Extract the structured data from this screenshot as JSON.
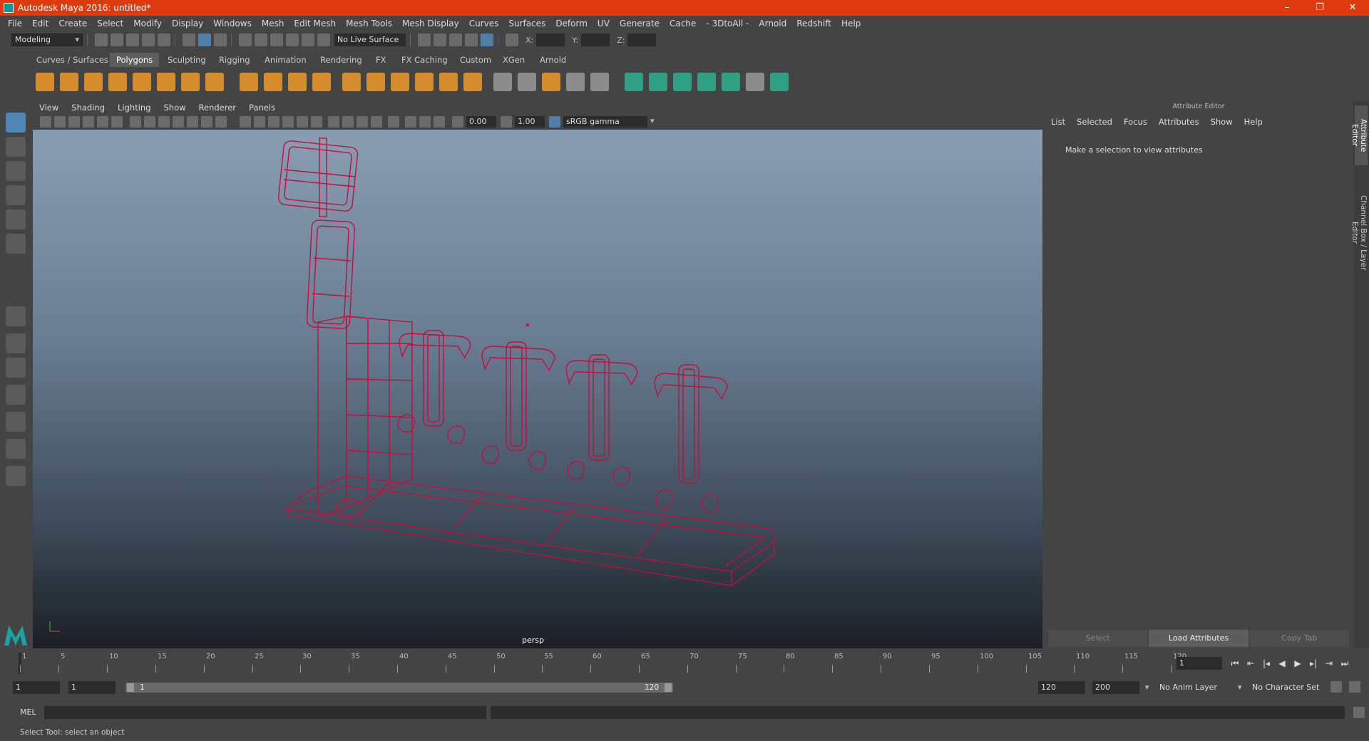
{
  "window": {
    "title": "Autodesk Maya 2016: untitled*",
    "minimize": "–",
    "maximize": "❐",
    "close": "✕"
  },
  "menubar": [
    "File",
    "Edit",
    "Create",
    "Select",
    "Modify",
    "Display",
    "Windows",
    "Mesh",
    "Edit Mesh",
    "Mesh Tools",
    "Mesh Display",
    "Curves",
    "Surfaces",
    "Deform",
    "UV",
    "Generate",
    "Cache",
    "- 3DtoAll -",
    "Arnold",
    "Redshift",
    "Help"
  ],
  "status_line": {
    "mode": "Modeling",
    "live_surface": "No Live Surface",
    "x_label": "X:",
    "y_label": "Y:",
    "z_label": "Z:"
  },
  "shelf": {
    "tabs": [
      "Curves / Surfaces",
      "Polygons",
      "Sculpting",
      "Rigging",
      "Animation",
      "Rendering",
      "FX",
      "FX Caching",
      "Custom",
      "XGen",
      "Arnold"
    ],
    "active_tab": "Polygons"
  },
  "panel": {
    "menus": [
      "View",
      "Shading",
      "Lighting",
      "Show",
      "Renderer",
      "Panels"
    ],
    "exposure": "0.00",
    "gamma": "1.00",
    "color_space": "sRGB gamma",
    "camera": "persp"
  },
  "attribute_editor": {
    "header": "Attribute Editor",
    "menus": [
      "List",
      "Selected",
      "Focus",
      "Attributes",
      "Show",
      "Help"
    ],
    "message": "Make a selection to view attributes",
    "buttons": {
      "select": "Select",
      "load": "Load Attributes",
      "copy": "Copy Tab"
    }
  },
  "side_tabs": {
    "attribute_editor": "Attribute Editor",
    "channel_box": "Channel Box / Layer Editor"
  },
  "timeline": {
    "ticks": [
      1,
      5,
      10,
      15,
      20,
      25,
      30,
      35,
      40,
      45,
      50,
      55,
      60,
      65,
      70,
      75,
      80,
      85,
      90,
      95,
      100,
      105,
      110,
      115,
      120
    ],
    "current_frame": "1"
  },
  "range": {
    "start": "1",
    "playback_start": "1",
    "slider_start": "1",
    "slider_end": "120",
    "playback_end": "120",
    "end": "200",
    "anim_layer": "No Anim Layer",
    "character_set": "No Character Set"
  },
  "command_line": {
    "lang": "MEL"
  },
  "help_line": {
    "text": "Select Tool: select an object"
  },
  "colors": {
    "titlebar": "#dd3b0e",
    "wireframe": "#c0103c",
    "shelf_orange": "#d48c2c",
    "shelf_teal": "#2fa084"
  }
}
